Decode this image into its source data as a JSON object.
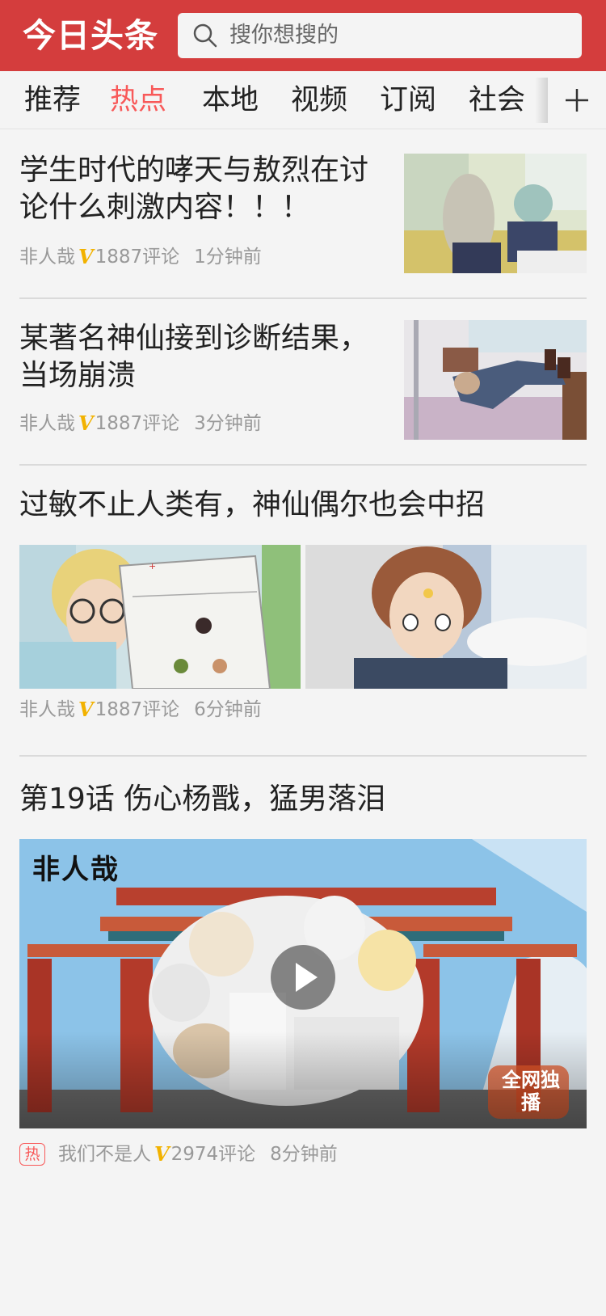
{
  "header": {
    "logo": "今日头条",
    "search_placeholder": "搜你想搜的",
    "bg_color": "#d43d3d"
  },
  "tabs": {
    "items": [
      {
        "label": "推荐",
        "active": false
      },
      {
        "label": "热点",
        "active": true
      },
      {
        "label": "本地",
        "active": false
      },
      {
        "label": "视频",
        "active": false
      },
      {
        "label": "订阅",
        "active": false
      },
      {
        "label": "社会",
        "active": false
      }
    ],
    "add_icon": "plus-icon",
    "active_color": "#f85959"
  },
  "feed": [
    {
      "title_lines": [
        "学生时代的哮天与敖烈在讨",
        "论什么刺激内容！！！"
      ],
      "author": "非人哉",
      "verified_icon": "v-icon",
      "comments": "1887评论",
      "time": "1分钟前"
    },
    {
      "title_lines": [
        "某著名神仙接到诊断结果，",
        "当场崩溃"
      ],
      "author": "非人哉",
      "verified_icon": "v-icon",
      "comments": "1887评论",
      "time": "3分钟前"
    },
    {
      "title_lines": [
        "过敏不止人类有，神仙偶尔也会中招"
      ],
      "author": "非人哉",
      "verified_icon": "v-icon",
      "comments": "1887评论",
      "time": "6分钟前"
    },
    {
      "title_lines": [
        "第19话 伤心杨戬，猛男落泪"
      ],
      "hot_badge": "热",
      "author": "我们不是人",
      "verified_icon": "v-icon",
      "comments": "2974评论",
      "time": "8分钟前",
      "video_overlay_text": "非人哉",
      "video_watermark": "全网独播",
      "play_icon": "play-icon"
    }
  ]
}
